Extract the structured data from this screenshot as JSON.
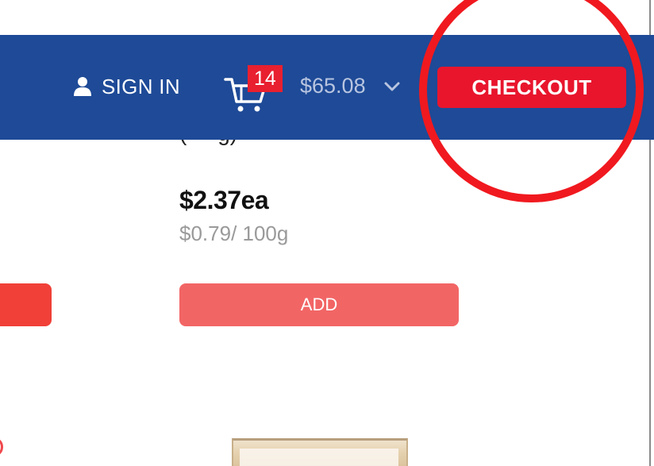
{
  "header": {
    "sign_in_label": "SIGN IN",
    "cart_count": "14",
    "cart_total": "$65.08",
    "checkout_label": "CHECKOUT",
    "background_color": "#1e4a97",
    "checkout_color": "#e8152d"
  },
  "product": {
    "price": "$2.37ea",
    "unit_price": "$0.79/ 100g",
    "add_label": "ADD",
    "add_color": "#f26565"
  },
  "icons": {
    "user": "person-icon",
    "cart": "cart-icon",
    "dropdown": "chevron-down-icon"
  },
  "annotation": {
    "circle_color": "#f0191f"
  }
}
